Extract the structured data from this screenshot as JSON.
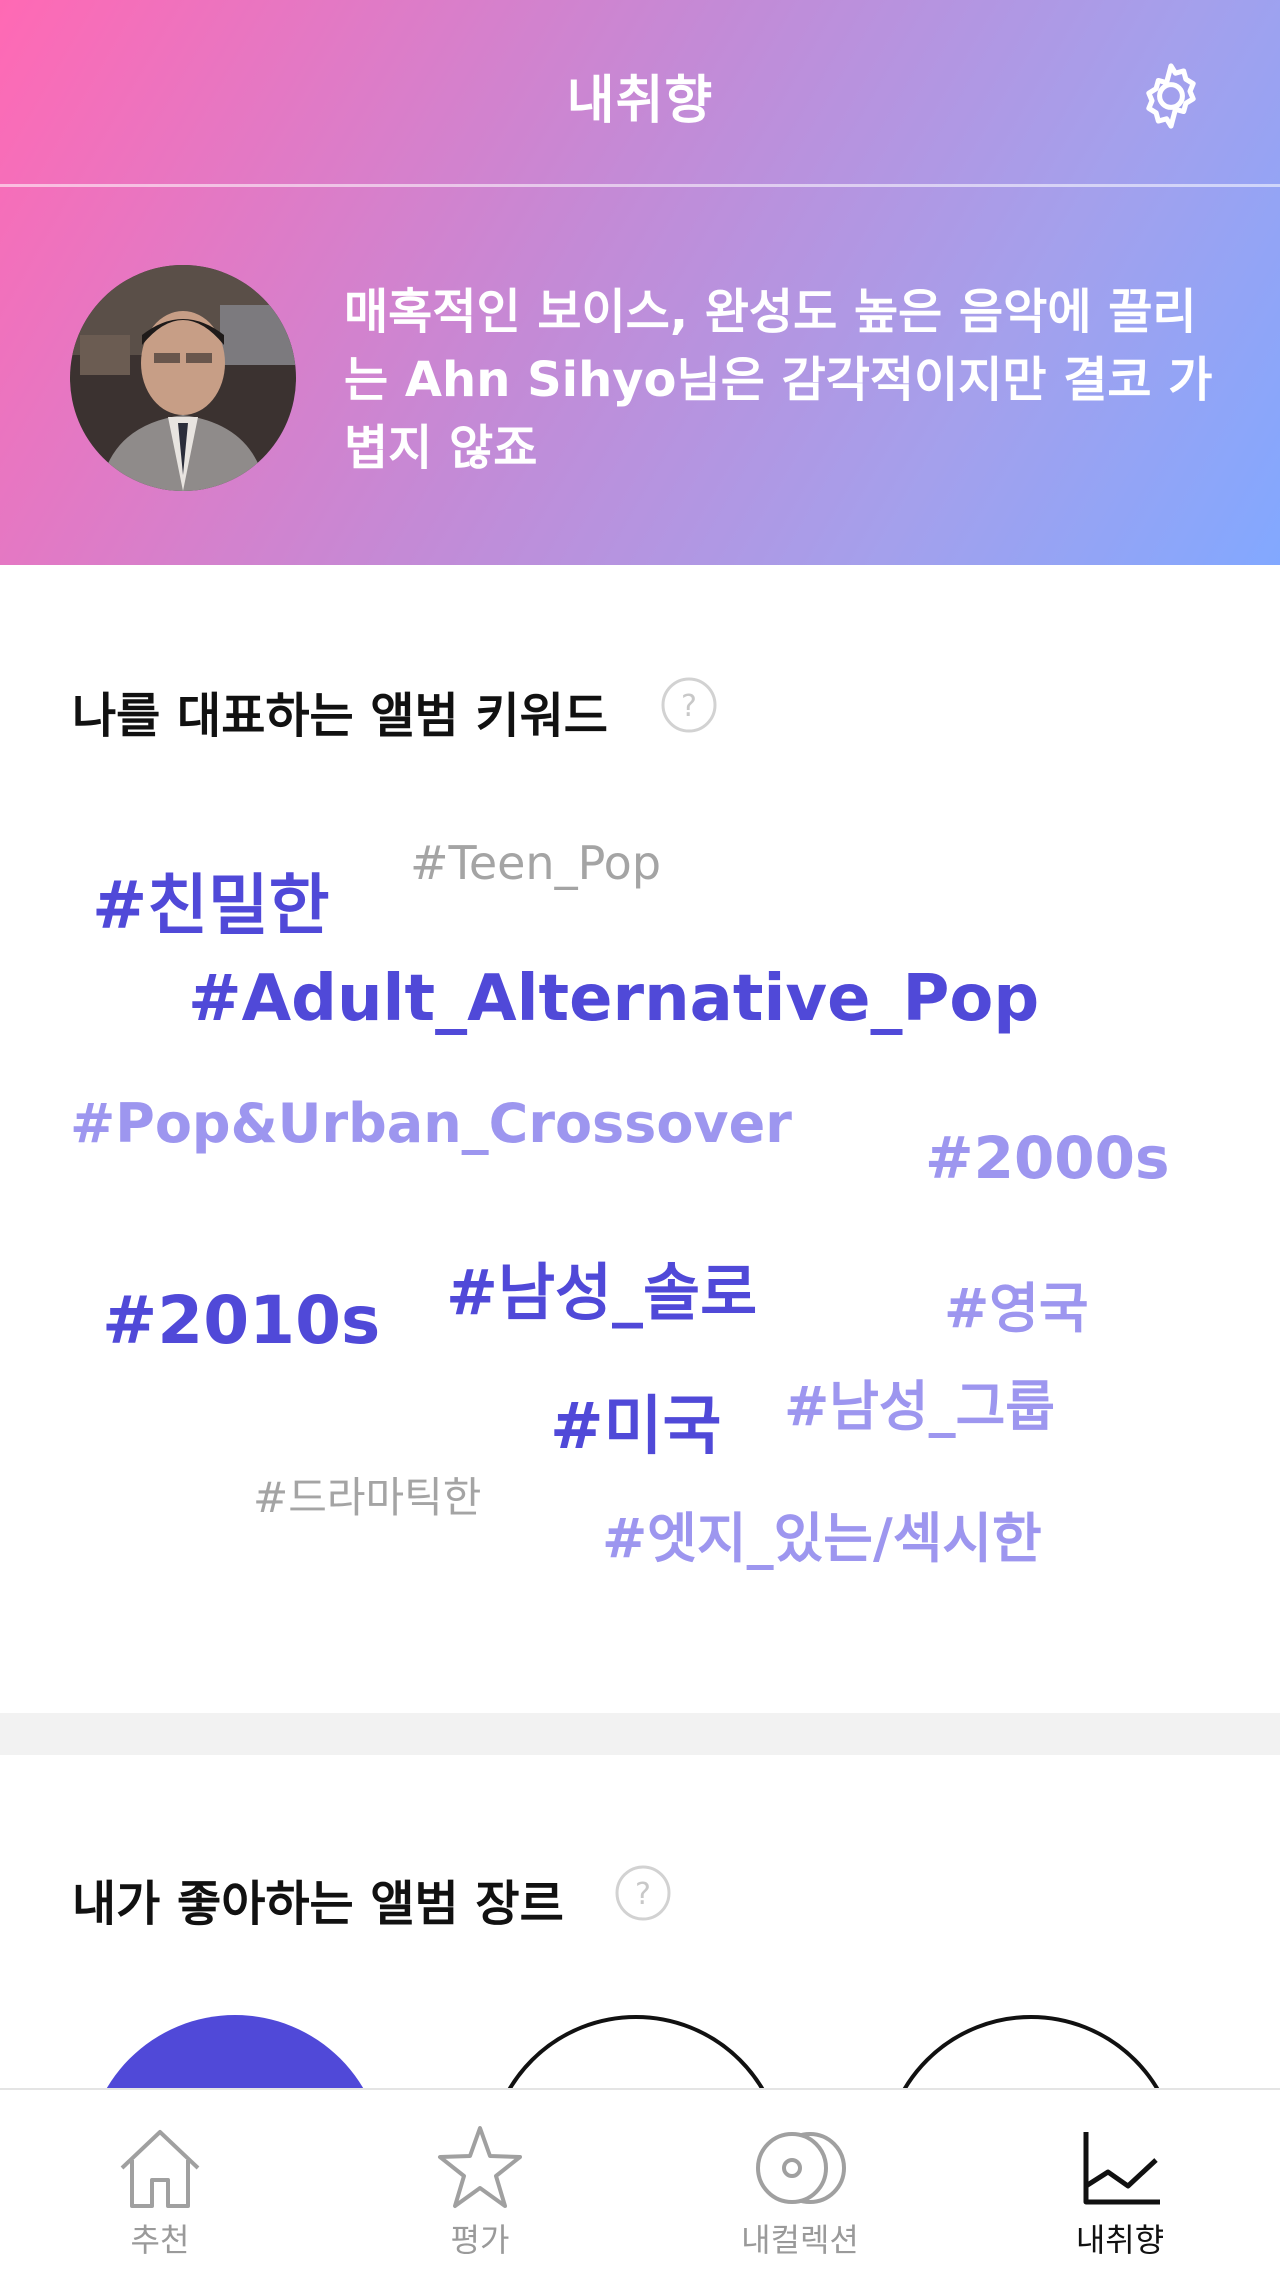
{
  "header": {
    "title": "내취향",
    "settings_icon": "gear-icon"
  },
  "profile": {
    "description": "매혹적인 보이스, 완성도 높은 음악에 끌리는 Ahn Sihyo님은 감각적이지만 결코 가볍지 않죠"
  },
  "keywords_section": {
    "title": "나를 대표하는 앨범 키워드",
    "help_icon": "question-circle-icon",
    "keywords": [
      "#친밀한",
      "#Teen_Pop",
      "#Adult_Alternative_Pop",
      "#Pop&Urban_Crossover",
      "#2000s",
      "#남성_솔로",
      "#2010s",
      "#영국",
      "#미국",
      "#남성_그룹",
      "#드라마틱한",
      "#엣지_있는/섹시한"
    ]
  },
  "genres_section": {
    "title": "내가 좋아하는 앨범 장르",
    "help_icon": "question-circle-icon"
  },
  "bottom_nav": {
    "items": [
      {
        "label": "추천",
        "icon": "home-icon",
        "active": false
      },
      {
        "label": "평가",
        "icon": "star-icon",
        "active": false
      },
      {
        "label": "내컬렉션",
        "icon": "disc-icon",
        "active": false
      },
      {
        "label": "내취향",
        "icon": "chart-icon",
        "active": true
      }
    ]
  },
  "colors": {
    "gradient_start": "#ff69b4",
    "gradient_end": "#82a8ff",
    "keyword_dark": "#5049d8",
    "keyword_light": "#9d96ef",
    "keyword_gray": "#a4a4a4"
  }
}
